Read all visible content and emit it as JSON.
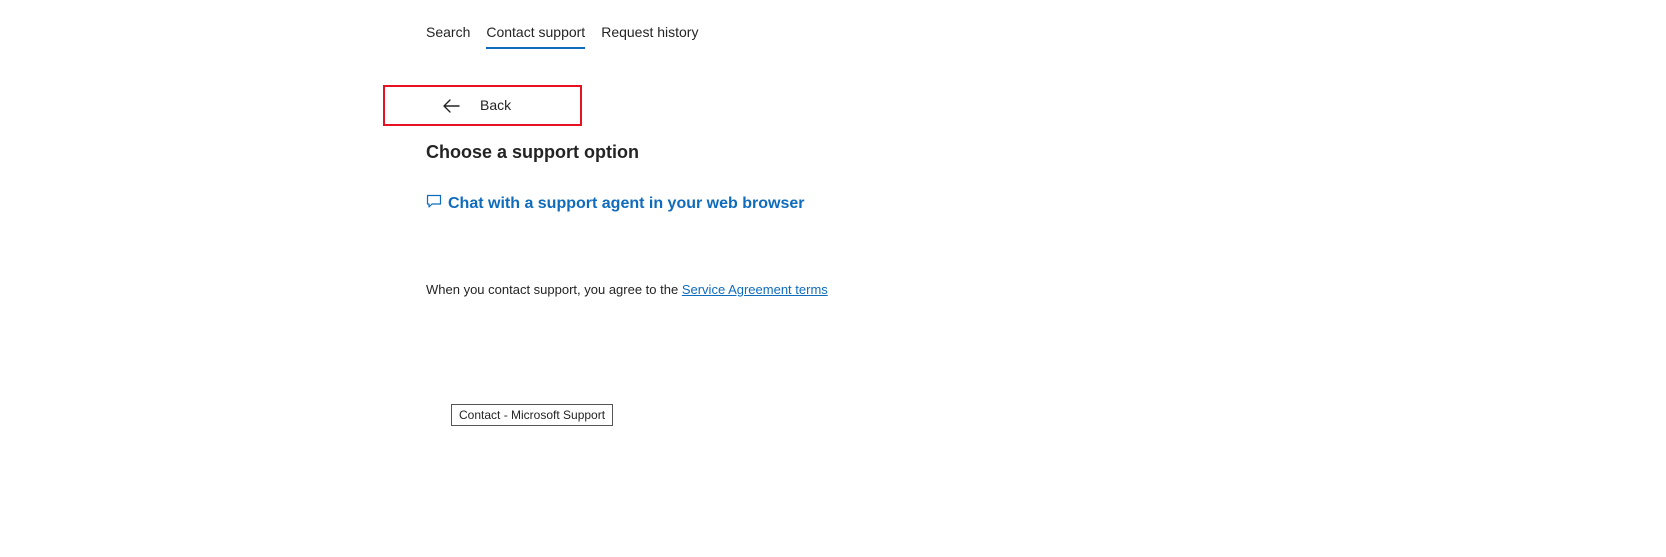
{
  "tabs": [
    {
      "label": "Search",
      "active": false
    },
    {
      "label": "Contact support",
      "active": true
    },
    {
      "label": "Request history",
      "active": false
    }
  ],
  "back": {
    "label": "Back",
    "icon": "arrow-left-icon",
    "highlight_color": "#e81123"
  },
  "main": {
    "title": "Choose a support option",
    "chat_link": {
      "label": "Chat with a support agent in your web browser",
      "icon": "chat-bubble-icon"
    },
    "agreement": {
      "text": "When you contact support, you agree to the ",
      "link_label": "Service Agreement terms"
    }
  },
  "tooltip": {
    "text": "Contact - Microsoft Support"
  },
  "colors": {
    "accent": "#0f6cbd",
    "text": "#242424"
  }
}
